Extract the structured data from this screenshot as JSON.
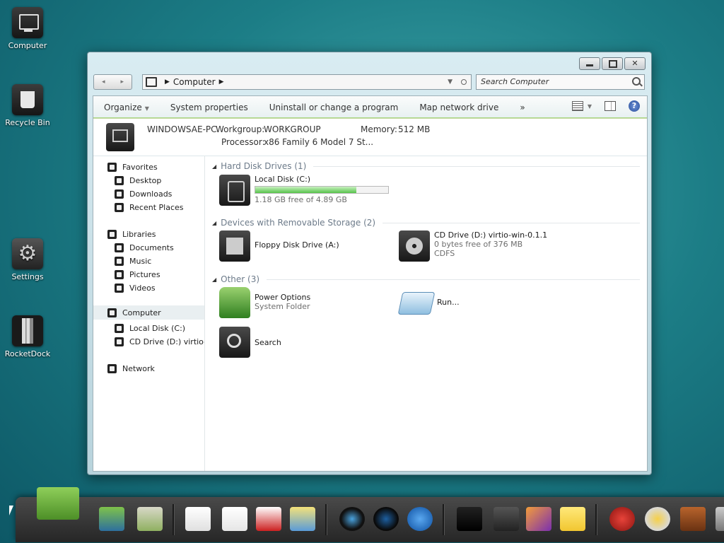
{
  "desktop": {
    "icons": [
      {
        "label": "Computer",
        "icon": "computer-icon"
      },
      {
        "label": "Recycle Bin",
        "icon": "recycle-bin-icon"
      },
      {
        "label": "Settings",
        "icon": "settings-gear-icon"
      },
      {
        "label": "RocketDock",
        "icon": "rocketdock-icon"
      }
    ]
  },
  "window": {
    "address": {
      "segment": "Computer"
    },
    "search": {
      "placeholder": "Search Computer"
    },
    "toolbar": {
      "organize": "Organize",
      "system_properties": "System properties",
      "uninstall": "Uninstall or change a program",
      "map_drive": "Map network drive",
      "more": "»"
    },
    "details": {
      "pc_name": "WINDOWSAE-PC",
      "workgroup_label": "Workgroup:",
      "workgroup_value": "WORKGROUP",
      "memory_label": "Memory:",
      "memory_value": "512 MB",
      "processor_label": "Processor:",
      "processor_value": "x86 Family 6 Model 7 St..."
    },
    "nav": {
      "favorites": "Favorites",
      "desktop": "Desktop",
      "downloads": "Downloads",
      "recent": "Recent Places",
      "libraries": "Libraries",
      "documents": "Documents",
      "music": "Music",
      "pictures": "Pictures",
      "videos": "Videos",
      "computer": "Computer",
      "local_disk": "Local Disk (C:)",
      "cd_drive": "CD Drive (D:) virtio-w",
      "network": "Network"
    },
    "groups": {
      "hdd": "Hard Disk Drives (1)",
      "removable": "Devices with Removable Storage (2)",
      "other": "Other (3)"
    },
    "items": {
      "local_disk": {
        "name": "Local Disk (C:)",
        "free": "1.18 GB free of 4.89 GB",
        "used_fraction": 0.76
      },
      "floppy": {
        "name": "Floppy Disk Drive (A:)"
      },
      "cd": {
        "name": "CD Drive (D:) virtio-win-0.1.1",
        "free": "0 bytes free of 376 MB",
        "fs": "CDFS"
      },
      "power": {
        "name": "Power Options",
        "type": "System Folder"
      },
      "run": {
        "name": "Run..."
      },
      "search": {
        "name": "Search"
      }
    }
  },
  "dock": {
    "icons": [
      "android-icon",
      "computer-globe-icon",
      "android-folder-icon",
      "play-store-icon",
      "gmail-icon",
      "youtube-icon",
      "maps-icon",
      "camera-icon",
      "speaker-icon",
      "browser-globe-icon",
      "color-picker-icon",
      "calculator-icon",
      "photo-icon",
      "sticky-notes-icon",
      "angry-birds-icon",
      "weather-icon",
      "gingerbread-icon",
      "trash-icon"
    ]
  }
}
